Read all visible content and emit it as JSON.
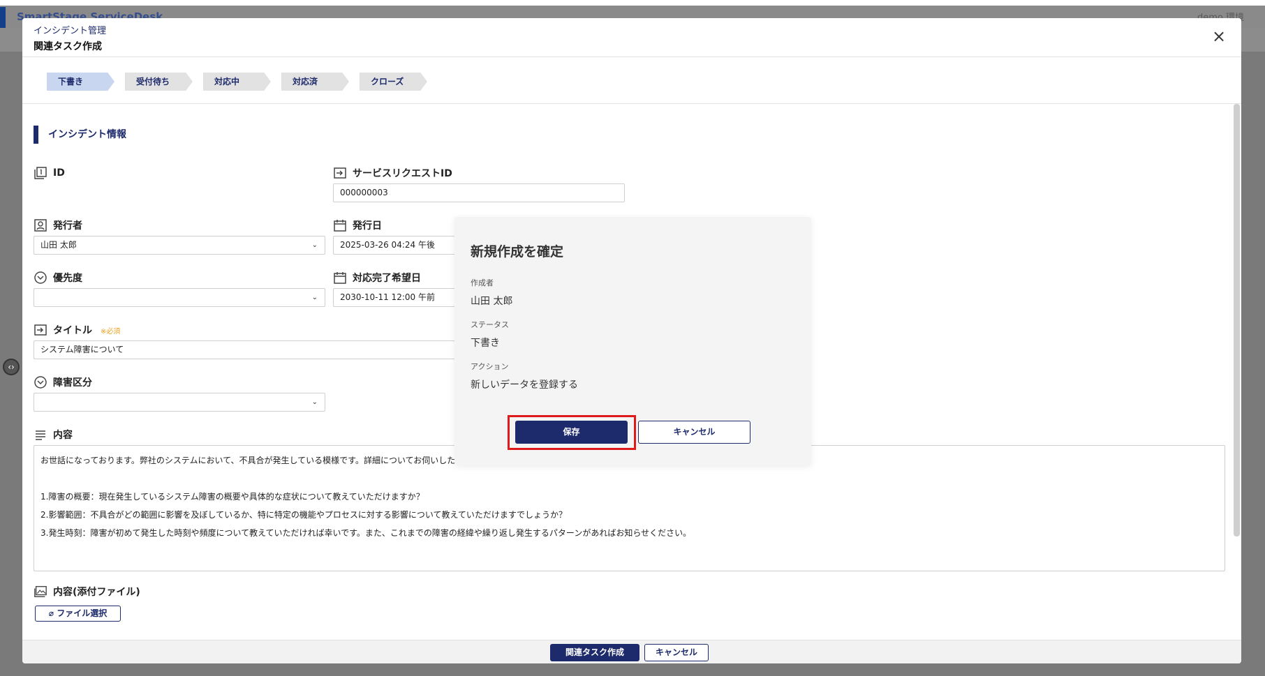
{
  "app": {
    "brand": "SmartStage ServiceDesk",
    "user": "demo 環境"
  },
  "panel": {
    "breadcrumb": "インシデント管理",
    "title": "関連タスク作成",
    "close_icon": "×"
  },
  "steps": [
    "下書き",
    "受付待ち",
    "対応中",
    "対応済",
    "クローズ"
  ],
  "section": {
    "title": "インシデント情報"
  },
  "fields": {
    "id": {
      "label": "ID"
    },
    "service_request_id": {
      "label": "サービスリクエストID",
      "value": "000000003"
    },
    "issuer": {
      "label": "発行者",
      "value": "山田 太郎"
    },
    "issue_date": {
      "label": "発行日",
      "value": "2025-03-26 04:24 午後"
    },
    "priority": {
      "label": "優先度",
      "value": ""
    },
    "desired_completion": {
      "label": "対応完了希望日",
      "value": "2030-10-11 12:00 午前"
    },
    "title": {
      "label": "タイトル",
      "required": "※必須",
      "value": "システム障害について"
    },
    "fault_category": {
      "label": "障害区分",
      "value": ""
    },
    "content": {
      "label": "内容",
      "lines": [
        "お世話になっております。弊社のシステムにおいて、不具合が発生している模様です。詳細についてお伺いした",
        "",
        "1.障害の概要：現在発生しているシステム障害の概要や具体的な症状について教えていただけますか？",
        "2.影響範囲：不具合がどの範囲に影響を及ぼしているか、特に特定の機能やプロセスに対する影響について教えていただけますでしょうか？",
        "3.発生時刻：障害が初めて発生した時刻や頻度について教えていただければ幸いです。また、これまでの障害の経緯や繰り返し発生するパターンがあればお知らせください。"
      ]
    },
    "attachment": {
      "label": "内容(添付ファイル)",
      "button": "ファイル選択"
    }
  },
  "footer": {
    "create": "関連タスク作成",
    "cancel": "キャンセル"
  },
  "dialog": {
    "title": "新規作成を確定",
    "creator_label": "作成者",
    "creator": "山田 太郎",
    "status_label": "ステータス",
    "status": "下書き",
    "action_label": "アクション",
    "action": "新しいデータを登録する",
    "save": "保存",
    "cancel": "キャンセル"
  },
  "colors": {
    "primary": "#1d2a6b",
    "active_step": "#c9d6f0",
    "highlight": "#e01a1a",
    "required": "#f0a020"
  }
}
